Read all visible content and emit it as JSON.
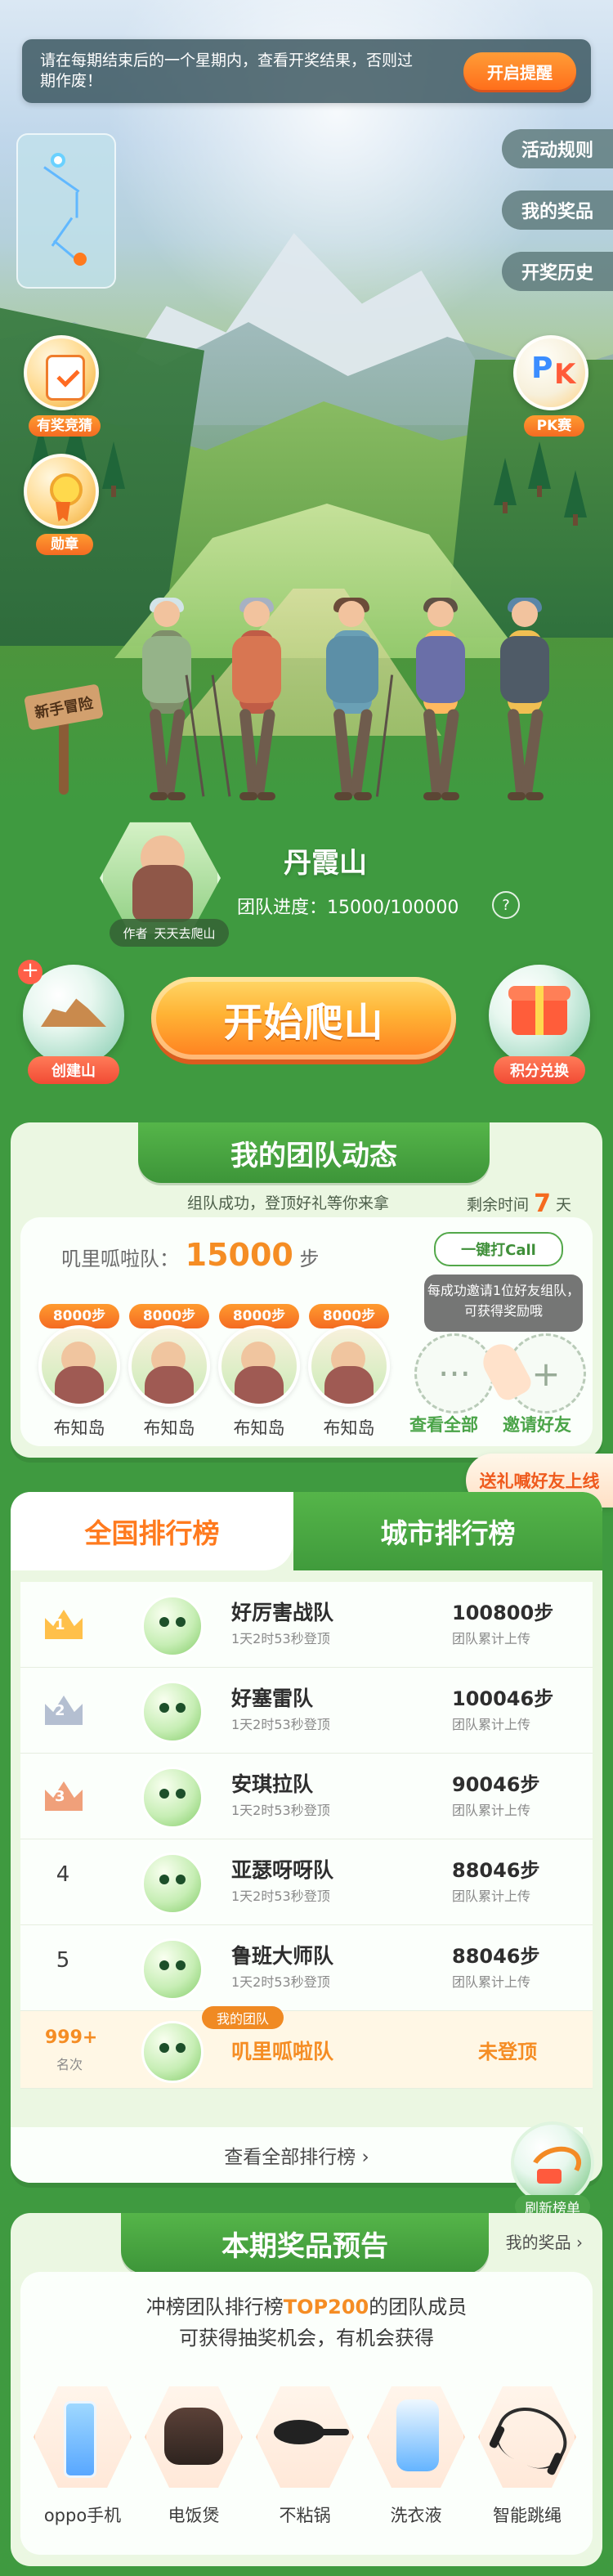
{
  "top_notice": {
    "text": "请在每期结束后的一个星期内，查看开奖结果，否则过期作废！",
    "button": "开启提醒"
  },
  "side_menu": [
    "活动规则",
    "我的奖品",
    "开奖历史"
  ],
  "floating_badges": {
    "left_1": "有奖竞猜",
    "left_2": "勋章",
    "right_1": "PK赛",
    "sign": "新手冒险"
  },
  "team": {
    "mountain": "丹霞山",
    "progress_label": "团队进度：15000/100000",
    "author_prefix": "作者",
    "author_name": "天天去爬山",
    "help": "?"
  },
  "actions": {
    "left": "创建山",
    "start": "开始爬山",
    "right": "积分兑换"
  },
  "dynamics": {
    "title": "我的团队动态",
    "subtitle": "组队成功，登顶好礼等你来拿",
    "remaining_prefix": "剩余时间",
    "remaining_value": "7",
    "remaining_suffix": "天",
    "team_label": "叽里呱啦队：",
    "team_steps": "15000",
    "team_unit": "步",
    "call_button": "一键打Call",
    "tip": "每成功邀请1位好友组队，可获得奖励哦",
    "members": [
      {
        "steps": "8000步",
        "name": "布知岛"
      },
      {
        "steps": "8000步",
        "name": "布知岛"
      },
      {
        "steps": "8000步",
        "name": "布知岛"
      },
      {
        "steps": "8000步",
        "name": "布知岛"
      }
    ],
    "more_label": "查看全部",
    "invite_label": "邀请好友",
    "corner_banner": "送礼喊好友上线"
  },
  "ranking": {
    "tabs": [
      "全国排行榜",
      "城市排行榜"
    ],
    "rows": [
      {
        "rank": "1",
        "name": "好厉害战队",
        "meta": "1天2时53秒登顶",
        "steps": "100800步",
        "steps_meta": "团队累计上传"
      },
      {
        "rank": "2",
        "name": "好塞雷队",
        "meta": "1天2时53秒登顶",
        "steps": "100046步",
        "steps_meta": "团队累计上传"
      },
      {
        "rank": "3",
        "name": "安琪拉队",
        "meta": "1天2时53秒登顶",
        "steps": "90046步",
        "steps_meta": "团队累计上传"
      },
      {
        "rank": "4",
        "name": "亚瑟呀呀队",
        "meta": "1天2时53秒登顶",
        "steps": "88046步",
        "steps_meta": "团队累计上传"
      },
      {
        "rank": "5",
        "name": "鲁班大师队",
        "meta": "1天2时53秒登顶",
        "steps": "88046步",
        "steps_meta": "团队累计上传"
      }
    ],
    "mine": {
      "badge": "我的团队",
      "rank": "999+",
      "rank_meta": "名次",
      "name": "叽里呱啦队",
      "status": "未登顶"
    },
    "view_all": "查看全部排行榜 ›",
    "refresh": "刷新榜单"
  },
  "prizes": {
    "title": "本期奖品预告",
    "my_prize_link": "我的奖品 ›",
    "desc_line1_before": "冲榜团队排行榜",
    "desc_highlight": "TOP200",
    "desc_line1_after": "的团队成员",
    "desc_line2": "可获得抽奖机会，有机会获得",
    "items": [
      "oppo手机",
      "电饭煲",
      "不粘锅",
      "洗衣液",
      "智能跳绳"
    ]
  }
}
